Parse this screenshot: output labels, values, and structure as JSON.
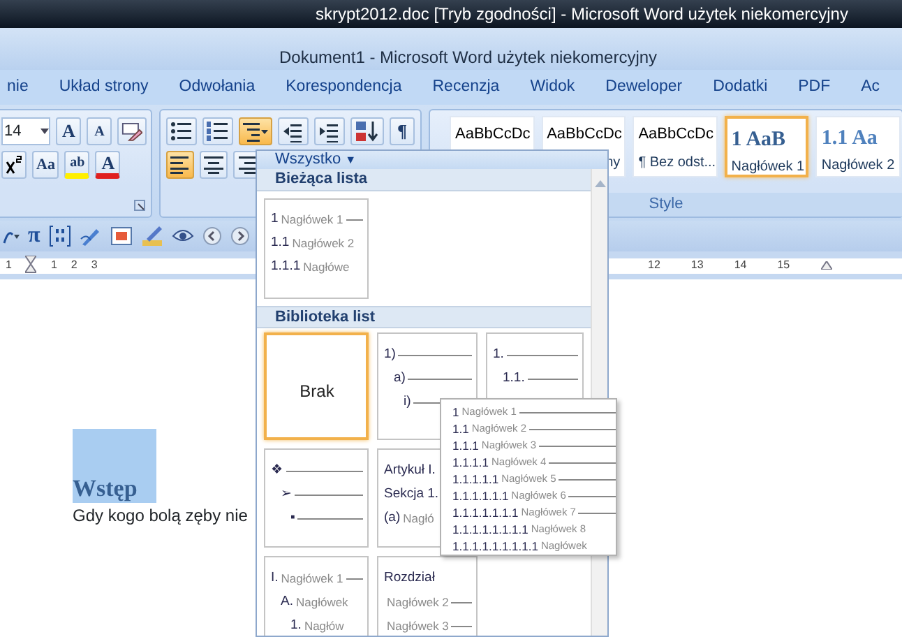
{
  "window": {
    "title": "skrypt2012.doc [Tryb zgodności] - Microsoft Word użytek niekomercyjny"
  },
  "document_window": {
    "title": "Dokument1 - Microsoft Word użytek niekomercyjny"
  },
  "ribbon_tabs": [
    "nie",
    "Układ strony",
    "Odwołania",
    "Korespondencja",
    "Recenzja",
    "Widok",
    "Deweloper",
    "Dodatki",
    "PDF",
    "Ac"
  ],
  "font_group": {
    "font_size": "14",
    "row1": [
      {
        "kind": "grow",
        "glyph": "A"
      },
      {
        "kind": "shrink",
        "glyph": "A"
      },
      {
        "kind": "clear"
      }
    ],
    "row2": [
      {
        "kind": "superscript"
      },
      {
        "kind": "case",
        "glyph": "Aa"
      },
      {
        "kind": "highlight",
        "glyph": "ab"
      },
      {
        "kind": "font-color",
        "glyph": "A"
      }
    ]
  },
  "paragraph_group": {
    "row1": [
      {
        "kind": "bullets",
        "selected": false
      },
      {
        "kind": "numbering",
        "selected": false
      },
      {
        "kind": "multilevel",
        "selected": true
      },
      {
        "kind": "outdent",
        "selected": false
      },
      {
        "kind": "indent",
        "selected": false
      },
      {
        "kind": "sort",
        "selected": false
      },
      {
        "kind": "pilcrow",
        "glyph": "¶",
        "selected": false
      }
    ],
    "row2": [
      {
        "kind": "align-left",
        "selected": true
      },
      {
        "kind": "align-center",
        "selected": false
      },
      {
        "kind": "align-right",
        "selected": false
      }
    ]
  },
  "styles_group": {
    "label": "Style",
    "items": [
      {
        "preview": "AaBbCcDc",
        "kind": "normal",
        "selected": false
      },
      {
        "preview": "AaBbCcDc",
        "label": "ny",
        "kind": "normal",
        "selected": false
      },
      {
        "preview": "AaBbCcDc",
        "label": "¶ Bez odst...",
        "kind": "normal",
        "selected": false
      },
      {
        "preview": "1 AaB",
        "label": "Nagłówek 1",
        "kind": "heading",
        "selected": true
      },
      {
        "preview": "1.1 Aa",
        "label": "Nagłówek 2",
        "kind": "heading",
        "selected": false
      }
    ]
  },
  "quick_toolbar": [
    {
      "kind": "equation"
    },
    {
      "kind": "pi",
      "glyph": "π"
    },
    {
      "kind": "matrix"
    },
    {
      "kind": "pen"
    },
    {
      "kind": "picture"
    },
    {
      "kind": "edit"
    },
    {
      "kind": "eye"
    },
    {
      "kind": "back"
    },
    {
      "kind": "forward"
    }
  ],
  "ruler": {
    "left_numbers": [
      "1",
      "1",
      "2",
      "3"
    ],
    "right_numbers": [
      "12",
      "13",
      "14",
      "15"
    ]
  },
  "document": {
    "heading": "Wstęp",
    "heading_selected": true,
    "body": "Gdy kogo bolą zęby nie"
  },
  "list_menu": {
    "filter": "Wszystko",
    "filter_arrow": "▼",
    "current_header": "Bieżąca lista",
    "current_list": {
      "lines": [
        {
          "marker": "1",
          "text": "Nagłówek 1",
          "rule": true
        },
        {
          "marker": "1.1",
          "text": "Nagłówek 2"
        },
        {
          "marker": "1.1.1",
          "text": "Nagłówe"
        }
      ]
    },
    "library_header": "Biblioteka list",
    "library": [
      [
        {
          "kind": "none",
          "label": "Brak",
          "selected": true
        },
        {
          "kind": "stepped",
          "selected": false,
          "lines": [
            {
              "marker": "1)",
              "rule": true
            },
            {
              "marker": "a)",
              "rule": true
            },
            {
              "marker": "i)",
              "rule": true
            }
          ]
        },
        {
          "kind": "stepped",
          "selected": false,
          "lines": [
            {
              "marker": "1.",
              "rule": true
            },
            {
              "marker": "1.1.",
              "rule": true
            }
          ]
        }
      ],
      [
        {
          "kind": "stepped",
          "selected": false,
          "lines": [
            {
              "marker": "❖",
              "rule": true
            },
            {
              "marker": "➢",
              "rule": true
            },
            {
              "marker": "▪",
              "rule": true
            }
          ]
        },
        {
          "kind": "flat",
          "selected": false,
          "lines": [
            {
              "marker": "Artykuł I."
            },
            {
              "marker": "Sekcja 1."
            },
            {
              "marker": "(a)",
              "text": "Nagłó"
            }
          ]
        }
      ],
      [
        {
          "kind": "stepped",
          "selected": false,
          "lines": [
            {
              "marker": "I.",
              "text": "Nagłówek 1",
              "rule": true
            },
            {
              "marker": "A.",
              "text": "Nagłówek"
            },
            {
              "marker": "1.",
              "text": "Nagłów"
            }
          ]
        },
        {
          "kind": "flat",
          "selected": false,
          "lines": [
            {
              "marker": "Rozdział"
            },
            {
              "text": "Nagłówek 2",
              "rule": true
            },
            {
              "text": "Nagłówek 3",
              "rule": true
            }
          ]
        }
      ]
    ]
  },
  "preview_tooltip": {
    "lines": [
      {
        "marker": "1",
        "text": "Nagłówek 1",
        "rule": true
      },
      {
        "marker": "1.1",
        "text": "Nagłówek 2",
        "rule": true
      },
      {
        "marker": "1.1.1",
        "text": "Nagłówek 3",
        "rule": true
      },
      {
        "marker": "1.1.1.1",
        "text": "Nagłówek 4",
        "rule": true
      },
      {
        "marker": "1.1.1.1.1",
        "text": "Nagłówek 5",
        "rule": true
      },
      {
        "marker": "1.1.1.1.1.1",
        "text": "Nagłówek 6",
        "rule": true
      },
      {
        "marker": "1.1.1.1.1.1.1",
        "text": "Nagłówek 7",
        "rule": true
      },
      {
        "marker": "1.1.1.1.1.1.1.1",
        "text": "Nagłówek 8"
      },
      {
        "marker": "1.1.1.1.1.1.1.1.1",
        "text": "Nagłówek"
      }
    ]
  }
}
